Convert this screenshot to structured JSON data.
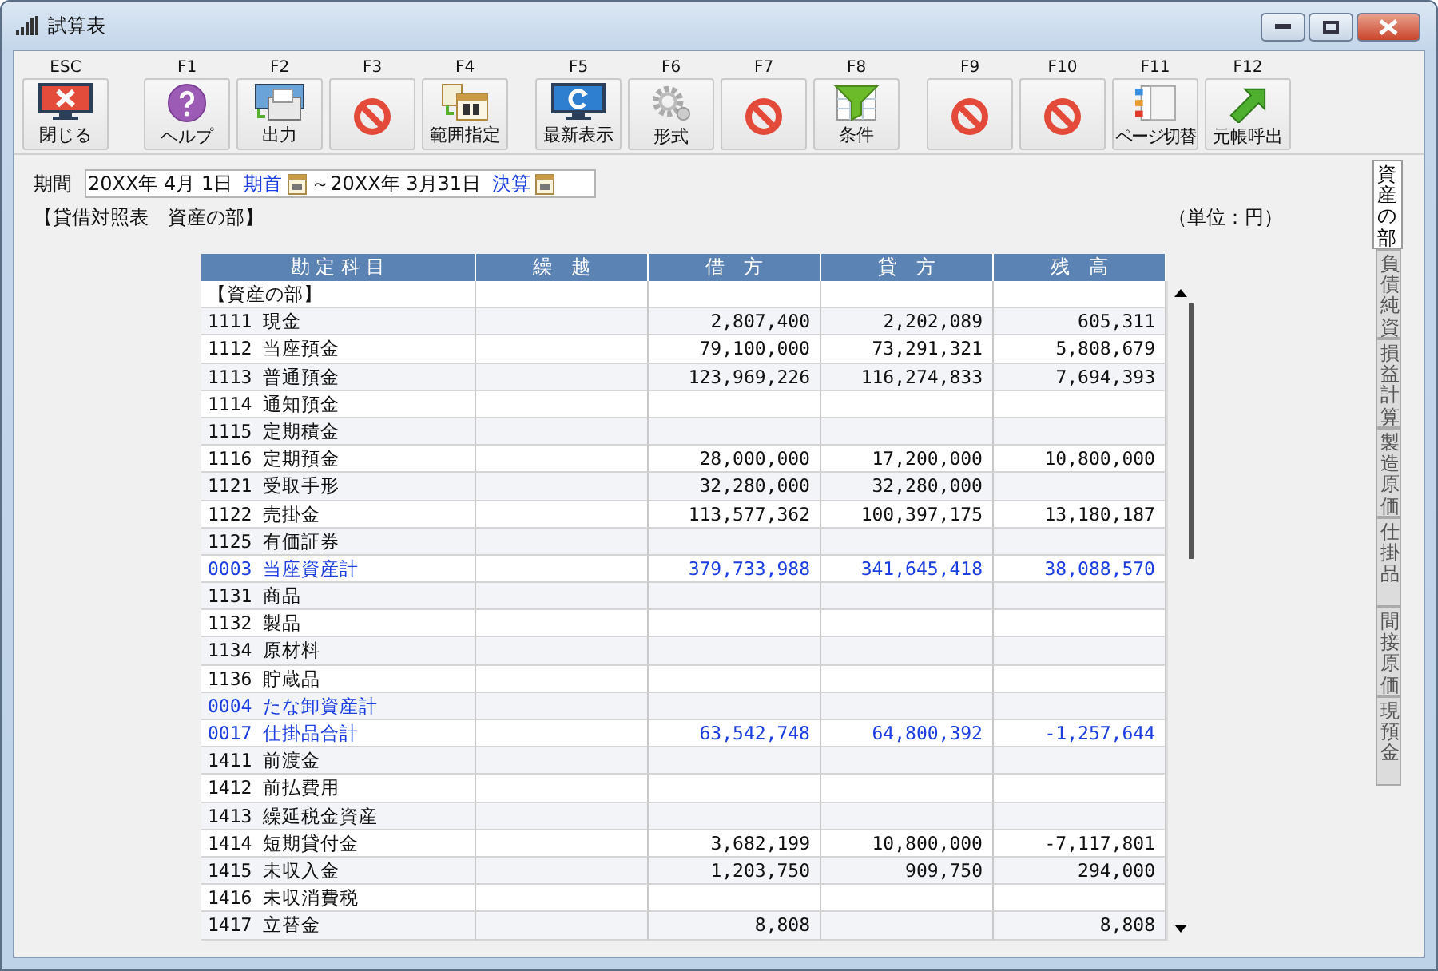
{
  "window": {
    "title": "試算表"
  },
  "toolbar": [
    {
      "key": "ESC",
      "kind": "close",
      "label": "閉じる"
    },
    {
      "key": "F1",
      "kind": "help",
      "label": "ヘルプ"
    },
    {
      "key": "F2",
      "kind": "output",
      "label": "出力"
    },
    {
      "key": "F3",
      "kind": "disabled"
    },
    {
      "key": "F4",
      "kind": "calendar",
      "label": "範囲指定"
    },
    {
      "key": "F5",
      "kind": "refresh",
      "label": "最新表示"
    },
    {
      "key": "F6",
      "kind": "gear",
      "label": "形式"
    },
    {
      "key": "F7",
      "kind": "disabled"
    },
    {
      "key": "F8",
      "kind": "filter",
      "label": "条件"
    },
    {
      "key": "F9",
      "kind": "disabled"
    },
    {
      "key": "F10",
      "kind": "disabled"
    },
    {
      "key": "F11",
      "kind": "pages",
      "label": "ページ切替"
    },
    {
      "key": "F12",
      "kind": "arrow",
      "label": "元帳呼出"
    }
  ],
  "period": {
    "label": "期間",
    "start": "20XX年 4月 1日",
    "start_button": "期首",
    "end": "～20XX年 3月31日",
    "end_button": "決算"
  },
  "heading": "【貸借対照表　資産の部】",
  "unit": "（単位：円）",
  "table": {
    "columns": [
      "勘 定 科 目",
      "繰　越",
      "借　方",
      "貸　方",
      "残　高"
    ],
    "rows": [
      {
        "kind": "section",
        "cells": [
          "【資産の部】",
          "",
          "",
          "",
          ""
        ]
      },
      {
        "kind": "account",
        "cells": [
          "1111 現金",
          "",
          "2,807,400",
          "2,202,089",
          "605,311"
        ]
      },
      {
        "kind": "account",
        "cells": [
          "1112 当座預金",
          "",
          "79,100,000",
          "73,291,321",
          "5,808,679"
        ]
      },
      {
        "kind": "account",
        "cells": [
          "1113 普通預金",
          "",
          "123,969,226",
          "116,274,833",
          "7,694,393"
        ]
      },
      {
        "kind": "account",
        "cells": [
          "1114 通知預金",
          "",
          "",
          "",
          ""
        ]
      },
      {
        "kind": "account",
        "cells": [
          "1115 定期積金",
          "",
          "",
          "",
          ""
        ]
      },
      {
        "kind": "account",
        "cells": [
          "1116 定期預金",
          "",
          "28,000,000",
          "17,200,000",
          "10,800,000"
        ]
      },
      {
        "kind": "account",
        "cells": [
          "1121 受取手形",
          "",
          "32,280,000",
          "32,280,000",
          ""
        ]
      },
      {
        "kind": "account",
        "cells": [
          "1122 売掛金",
          "",
          "113,577,362",
          "100,397,175",
          "13,180,187"
        ]
      },
      {
        "kind": "account",
        "cells": [
          "1125 有価証券",
          "",
          "",
          "",
          ""
        ]
      },
      {
        "kind": "total",
        "cells": [
          "0003 当座資産計",
          "",
          "379,733,988",
          "341,645,418",
          "38,088,570"
        ]
      },
      {
        "kind": "account",
        "cells": [
          "1131 商品",
          "",
          "",
          "",
          ""
        ]
      },
      {
        "kind": "account",
        "cells": [
          "1132 製品",
          "",
          "",
          "",
          ""
        ]
      },
      {
        "kind": "account",
        "cells": [
          "1134 原材料",
          "",
          "",
          "",
          ""
        ]
      },
      {
        "kind": "account",
        "cells": [
          "1136 貯蔵品",
          "",
          "",
          "",
          ""
        ]
      },
      {
        "kind": "total",
        "cells": [
          "0004 たな卸資産計",
          "",
          "",
          "",
          ""
        ]
      },
      {
        "kind": "total",
        "cells": [
          "0017 仕掛品合計",
          "",
          "63,542,748",
          "64,800,392",
          "-1,257,644"
        ]
      },
      {
        "kind": "account",
        "cells": [
          "1411 前渡金",
          "",
          "",
          "",
          ""
        ]
      },
      {
        "kind": "account",
        "cells": [
          "1412 前払費用",
          "",
          "",
          "",
          ""
        ]
      },
      {
        "kind": "account",
        "cells": [
          "1413 繰延税金資産",
          "",
          "",
          "",
          ""
        ]
      },
      {
        "kind": "account",
        "cells": [
          "1414 短期貸付金",
          "",
          "3,682,199",
          "10,800,000",
          "-7,117,801"
        ]
      },
      {
        "kind": "account",
        "cells": [
          "1415 未収入金",
          "",
          "1,203,750",
          "909,750",
          "294,000"
        ]
      },
      {
        "kind": "account",
        "cells": [
          "1416 未収消費税",
          "",
          "",
          "",
          ""
        ]
      },
      {
        "kind": "account",
        "cells": [
          "1417 立替金",
          "",
          "8,808",
          "",
          "8,808"
        ]
      }
    ]
  },
  "side_tabs": [
    {
      "label": "資産の部",
      "selected": true
    },
    {
      "label": "負債純資",
      "selected": false
    },
    {
      "label": "損益計算",
      "selected": false
    },
    {
      "label": "製造原価",
      "selected": false
    },
    {
      "label": "仕掛品",
      "selected": false
    },
    {
      "label": "間接原価",
      "selected": false
    },
    {
      "label": "現預金",
      "selected": false
    }
  ]
}
